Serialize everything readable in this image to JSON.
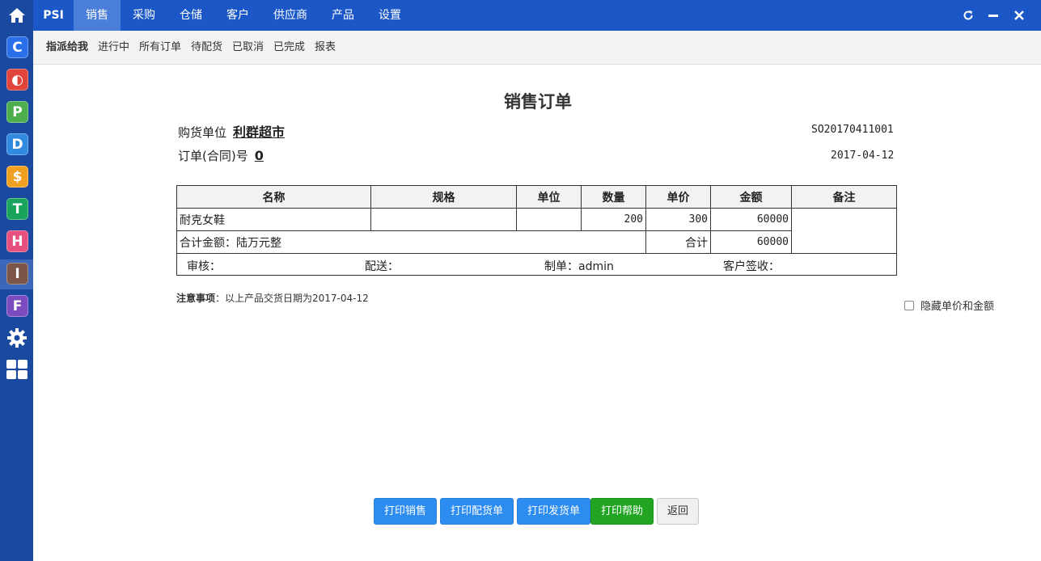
{
  "nav": {
    "brand": "PSI",
    "tabs": [
      "销售",
      "采购",
      "仓储",
      "客户",
      "供应商",
      "产品",
      "设置"
    ],
    "active_tab": "销售"
  },
  "subnav": {
    "items": [
      "指派给我",
      "进行中",
      "所有订单",
      "待配货",
      "已取消",
      "已完成",
      "报表"
    ],
    "active": "指派给我"
  },
  "rail": {
    "items": [
      {
        "letter": "C",
        "color": "#2b6fe8"
      },
      {
        "letter": "◐",
        "color": "#e0443a"
      },
      {
        "letter": "P",
        "color": "#4cae4c"
      },
      {
        "letter": "D",
        "color": "#2f8ae0"
      },
      {
        "letter": "$",
        "color": "#f0a020"
      },
      {
        "letter": "T",
        "color": "#1aa35a"
      },
      {
        "letter": "H",
        "color": "#e6507e"
      },
      {
        "letter": "I",
        "color": "#7a5548"
      },
      {
        "letter": "F",
        "color": "#7b4cc0"
      }
    ]
  },
  "doc": {
    "title": "销售订单",
    "buyer_label": "购货单位",
    "buyer_value": "利群超市",
    "order_no_label": "订单(合同)号",
    "order_no_value": "0",
    "serial": "SO20170411001",
    "date": "2017-04-12"
  },
  "table": {
    "headers": [
      "名称",
      "规格",
      "单位",
      "数量",
      "单价",
      "金额",
      "备注"
    ],
    "rows": [
      {
        "name": "耐克女鞋",
        "spec": "",
        "unit": "",
        "qty": "200",
        "price": "300",
        "amount": "60000",
        "remark": ""
      }
    ],
    "total_text": "合计金额：陆万元整",
    "total_label": "合计",
    "total_amount": "60000",
    "sign_audit": "审核：",
    "sign_delivery": "配送：",
    "sign_maker": "制单：admin",
    "sign_customer": "客户签收："
  },
  "note": {
    "label": "注意事项",
    "text": "：以上产品交货日期为2017-04-12"
  },
  "hide_option": "隐藏单价和金额",
  "buttons": {
    "print_sales": "打印销售",
    "print_picking": "打印配货单",
    "print_shipping": "打印发货单",
    "print_help": "打印帮助",
    "back": "返回"
  },
  "colors": {
    "topbar": "#1b57c7",
    "rail": "#1a4aa0",
    "primary_button": "#2d8cf0",
    "help_button": "#23a524"
  }
}
